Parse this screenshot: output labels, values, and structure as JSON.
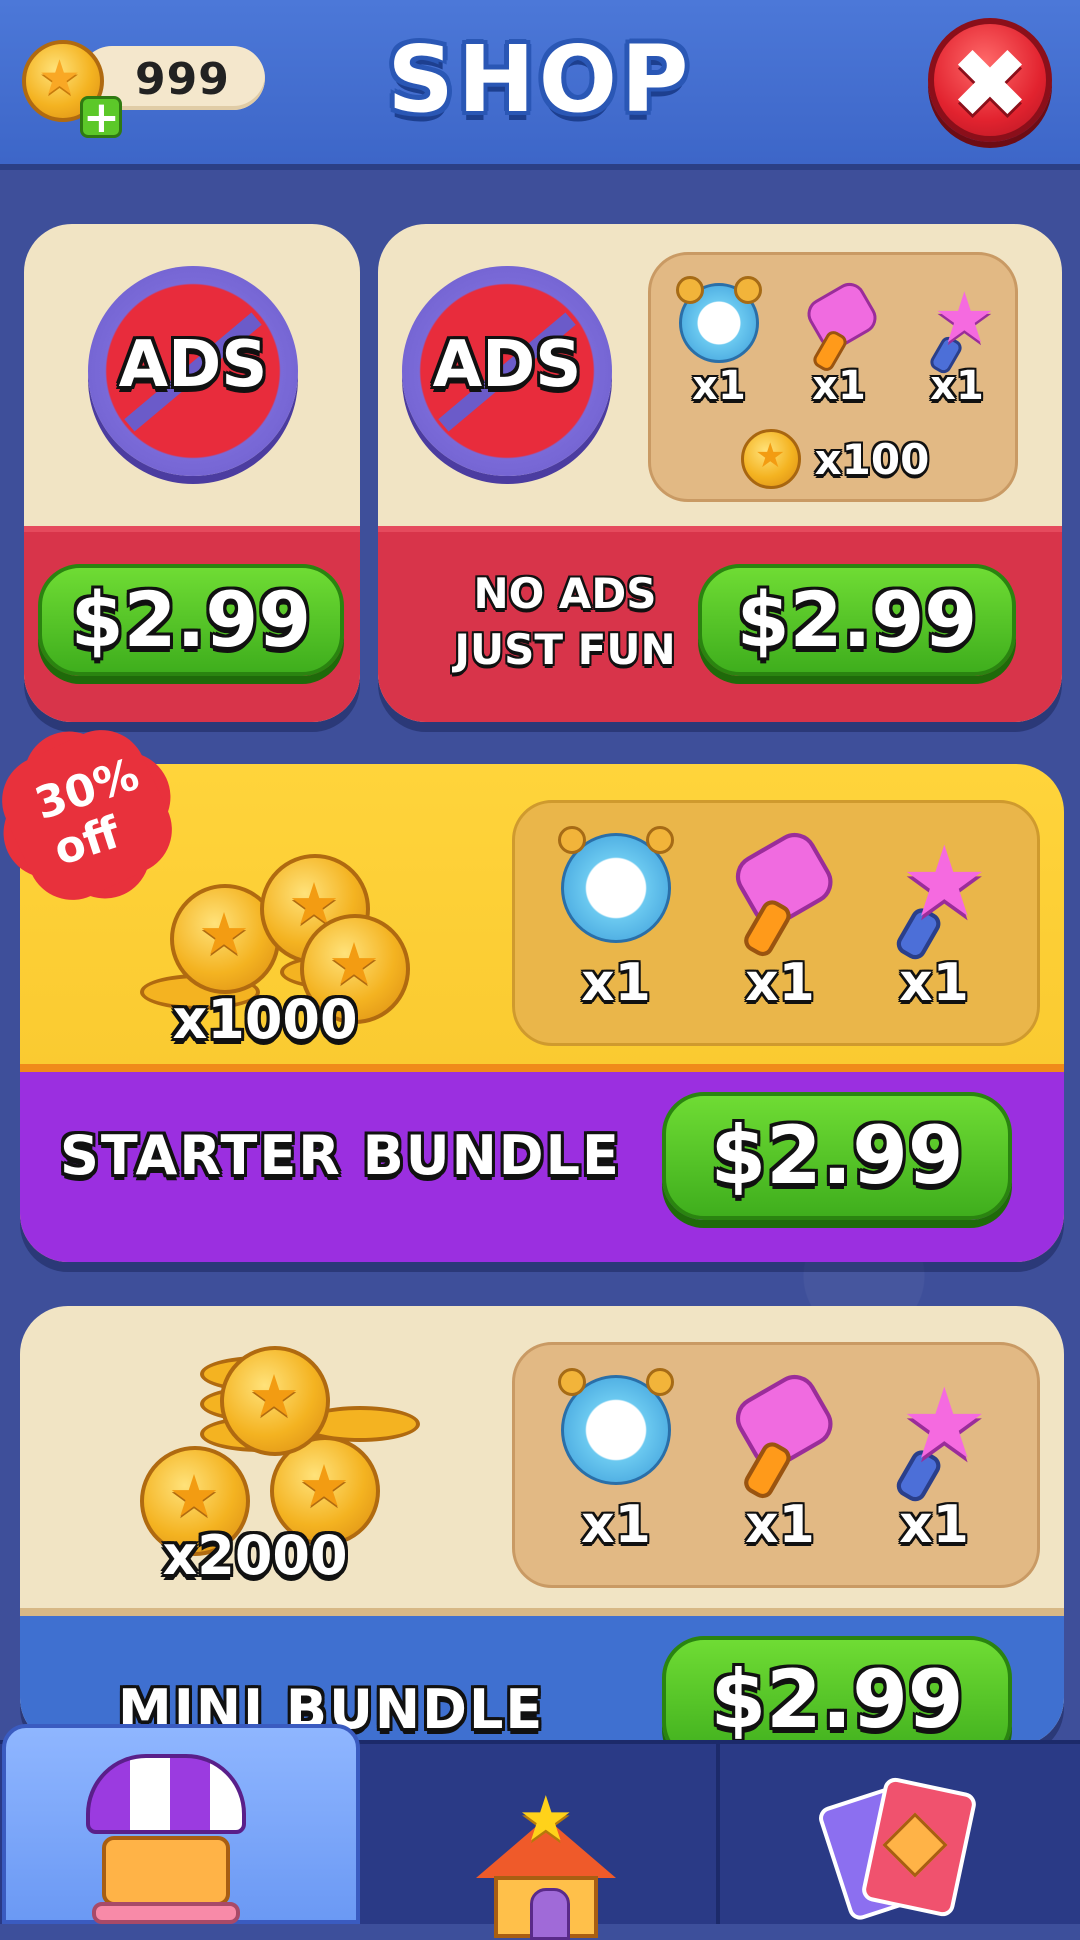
{
  "header": {
    "coins": "999",
    "title": "SHOP",
    "close_label": "✖"
  },
  "no_ads_card": {
    "badge": "ADS",
    "price": "$2.99"
  },
  "no_ads_plus_card": {
    "badge": "ADS",
    "items": [
      {
        "icon": "alarm-clock-icon",
        "qty": "x1"
      },
      {
        "icon": "hammer-icon",
        "qty": "x1"
      },
      {
        "icon": "star-wand-icon",
        "qty": "x1"
      }
    ],
    "coins_qty": "x100",
    "tagline_1": "NO ADS",
    "tagline_2": "JUST FUN",
    "price": "$2.99"
  },
  "starter_bundle": {
    "discount_1": "30%",
    "discount_2": "off",
    "coins_qty": "x1000",
    "items": [
      {
        "icon": "alarm-clock-icon",
        "qty": "x1"
      },
      {
        "icon": "hammer-icon",
        "qty": "x1"
      },
      {
        "icon": "star-wand-icon",
        "qty": "x1"
      }
    ],
    "name": "STARTER BUNDLE",
    "price": "$2.99"
  },
  "mini_bundle": {
    "coins_qty": "x2000",
    "items": [
      {
        "icon": "alarm-clock-icon",
        "qty": "x1"
      },
      {
        "icon": "hammer-icon",
        "qty": "x1"
      },
      {
        "icon": "star-wand-icon",
        "qty": "x1"
      }
    ],
    "name": "MINI BUNDLE",
    "price": "$2.99"
  },
  "nav": {
    "tabs": [
      {
        "icon": "shop-icon",
        "active": true
      },
      {
        "icon": "home-icon",
        "active": false
      },
      {
        "icon": "cards-icon",
        "active": false
      }
    ]
  },
  "colors": {
    "background": "#3e4f9a",
    "header": "#4c78d8",
    "green_button": "#4fc624",
    "red_band": "#d8344a",
    "purple_band": "#9b2fe0",
    "yellow_card": "#ffd43b",
    "cream_card": "#f1e4c4"
  }
}
